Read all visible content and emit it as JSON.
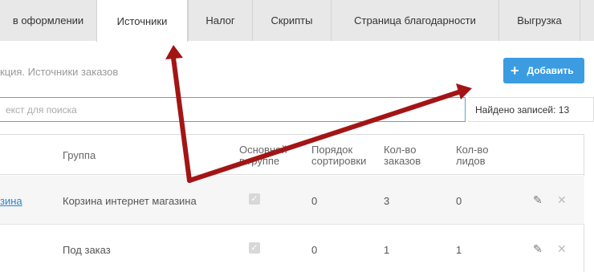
{
  "tabs": [
    {
      "label": "в оформлении"
    },
    {
      "label": "Источники"
    },
    {
      "label": "Налог"
    },
    {
      "label": "Скрипты"
    },
    {
      "label": "Страница благодарности"
    },
    {
      "label": "Выгрузка"
    }
  ],
  "active_tab": "Источники",
  "breadcrumb": "кция. Источники заказов",
  "add_button": {
    "label": "Добавить",
    "icon": "plus-icon"
  },
  "search": {
    "placeholder": "екст для поиска",
    "value": ""
  },
  "found_label": "Найдено записей: 13",
  "table": {
    "headers": {
      "group": "Группа",
      "main_line1": "Основной",
      "main_line2": "в группе",
      "order_line1": "Порядок",
      "order_line2": "сортировки",
      "orders_line1": "Кол-во",
      "orders_line2": "заказов",
      "leads_line1": "Кол-во",
      "leads_line2": "лидов"
    },
    "rows": [
      {
        "name": "зина",
        "group": "Корзина интернет магазина",
        "main": true,
        "sort": "0",
        "orders": "3",
        "leads": "0"
      },
      {
        "name": "",
        "group": "Под заказ",
        "main": true,
        "sort": "0",
        "orders": "1",
        "leads": "1"
      }
    ]
  },
  "annotation_color": "#a31515"
}
